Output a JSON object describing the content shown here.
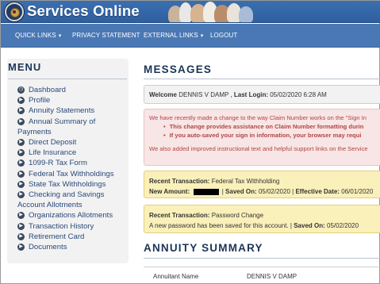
{
  "app": {
    "title": "Services Online"
  },
  "nav": {
    "items": [
      {
        "label": "Quick Links",
        "dropdown": true
      },
      {
        "label": "Privacy Statement",
        "dropdown": false
      },
      {
        "label": "External Links",
        "dropdown": true
      },
      {
        "label": "Logout",
        "dropdown": false
      }
    ]
  },
  "sidebar": {
    "title": "Menu",
    "items": [
      {
        "label": "Dashboard",
        "icon": "dashboard-icon"
      },
      {
        "label": "Profile",
        "icon": "arrow-circle-icon"
      },
      {
        "label": "Annuity Statements",
        "icon": "arrow-circle-icon"
      },
      {
        "label": "Annual Summary of Payments",
        "icon": "arrow-circle-icon"
      },
      {
        "label": "Direct Deposit",
        "icon": "arrow-circle-icon"
      },
      {
        "label": "Life Insurance",
        "icon": "arrow-circle-icon"
      },
      {
        "label": "1099-R Tax Form",
        "icon": "arrow-circle-icon"
      },
      {
        "label": "Federal Tax Withholdings",
        "icon": "arrow-circle-icon"
      },
      {
        "label": "State Tax Withholdings",
        "icon": "arrow-circle-icon"
      },
      {
        "label": "Checking and Savings Account Allotments",
        "icon": "arrow-circle-icon"
      },
      {
        "label": "Organizations Allotments",
        "icon": "arrow-circle-icon"
      },
      {
        "label": "Transaction History",
        "icon": "arrow-circle-icon"
      },
      {
        "label": "Retirement Card",
        "icon": "arrow-circle-icon"
      },
      {
        "label": "Documents",
        "icon": "arrow-circle-icon"
      }
    ]
  },
  "messages": {
    "title": "Messages",
    "welcome": {
      "label": "Welcome",
      "name": "DENNIS V DAMP",
      "last_login_label": "Last Login:",
      "last_login_value": "05/02/2020 6:28 AM"
    },
    "notice": {
      "intro": "We have recently made a change to the way Claim Number works on the \"Sign In",
      "bullets": [
        "This change provides assistance on Claim Number formatting durin",
        "If you auto-saved your sign in information, your browser may requi"
      ],
      "outro": "We also added improved instructional text and helpful support links on the Service"
    },
    "transactions": [
      {
        "label": "Recent Transaction:",
        "value": "Federal Tax Withholding",
        "amount_label": "New Amount:",
        "saved_on_label": "Saved On:",
        "saved_on": "05/02/2020",
        "effective_label": "Effective Date:",
        "effective_date": "06/01/2020"
      },
      {
        "label": "Recent Transaction:",
        "value": "Password Change",
        "description": "A new password has been saved for this account.",
        "saved_on_label": "Saved On:",
        "saved_on": "05/02/2020"
      }
    ]
  },
  "annuity_summary": {
    "title": "Annuity Summary",
    "rows": [
      {
        "label": "Annuitant Name",
        "value": "DENNIS V DAMP"
      }
    ]
  },
  "colors": {
    "header": "#3a6fb0",
    "nav": "#4a78b4",
    "section_title": "#1c3557",
    "notice_bg": "#f8e5e5",
    "notice_text": "#b04545",
    "txn_bg": "#faf0ba"
  }
}
